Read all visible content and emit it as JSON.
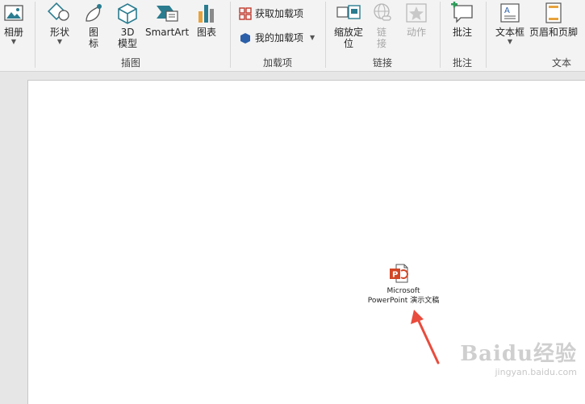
{
  "ribbon": {
    "album": {
      "label": "相册"
    },
    "shapes": {
      "label": "形状"
    },
    "icons": {
      "label_line1": "图",
      "label_line2": "标"
    },
    "model3d": {
      "label_line1": "3D",
      "label_line2": "模型"
    },
    "smartart": {
      "label": "SmartArt"
    },
    "chart": {
      "label": "图表"
    },
    "get_addins": {
      "label": "获取加载项"
    },
    "my_addins": {
      "label": "我的加载项"
    },
    "zoom": {
      "label_line1": "缩放定",
      "label_line2": "位"
    },
    "link": {
      "label_line1": "链",
      "label_line2": "接"
    },
    "action": {
      "label": "动作"
    },
    "comment": {
      "label": "批注"
    },
    "textbox": {
      "label": "文本框"
    },
    "header_footer": {
      "label": "页眉和页脚"
    },
    "groups": {
      "illustrations": "插图",
      "addins": "加载项",
      "links": "链接",
      "comments": "批注",
      "text": "文本"
    }
  },
  "slide": {
    "embedded_object": {
      "line1": "Microsoft",
      "line2": "PowerPoint 演示文稿"
    }
  },
  "watermark": {
    "brand": "Baidu经验",
    "url": "jingyan.baidu.com"
  },
  "colors": {
    "accent_red": "#e84c3d",
    "ppt_orange": "#d24726",
    "icon_teal": "#2b7c8f",
    "ribbon_bg": "#f3f3f3"
  }
}
